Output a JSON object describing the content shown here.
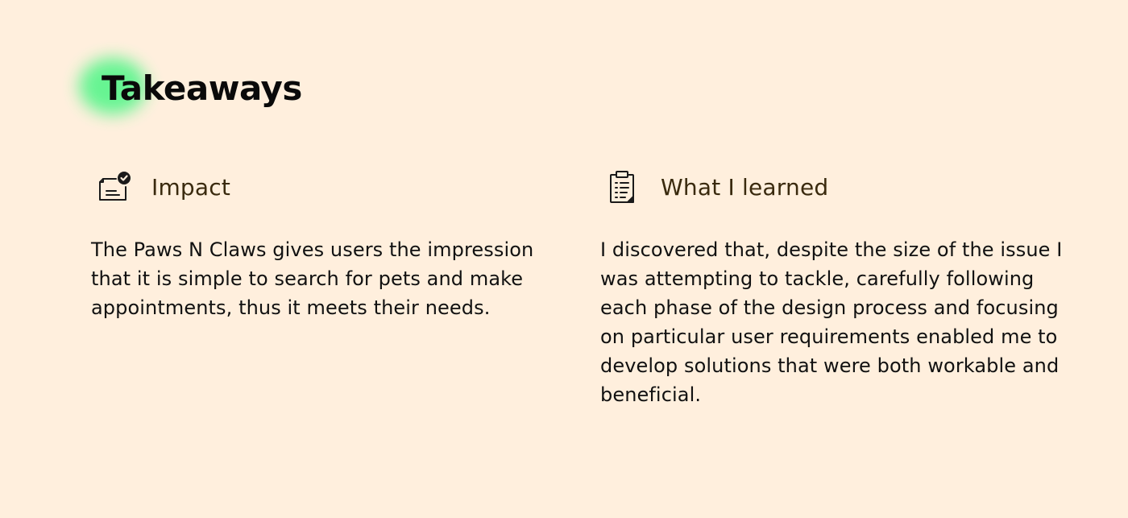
{
  "page": {
    "title": "Takeaways",
    "accent_color": "#5FF58F",
    "background_color": "#FFEFDD"
  },
  "sections": [
    {
      "icon": "document-check-icon",
      "title": "Impact",
      "body": "The Paws N Claws gives users the impression that it is simple to search for pets and make appointments, thus it meets their needs."
    },
    {
      "icon": "clipboard-list-icon",
      "title": "What I learned",
      "body": "I discovered that, despite the size of the issue I was attempting to tackle, carefully following each phase of the design process and focusing on particular user requirements enabled me to develop solutions that were both workable and beneficial."
    }
  ]
}
